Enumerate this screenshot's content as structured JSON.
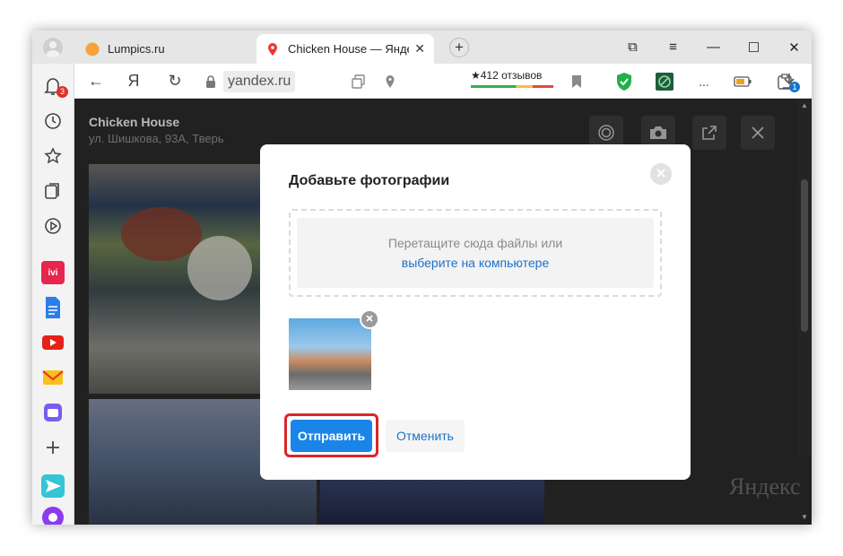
{
  "browser": {
    "tabs": [
      {
        "title": "Lumpics.ru",
        "favicon": "orange-circle-icon"
      },
      {
        "title": "Chicken House — Яндекс",
        "favicon": "map-pin-icon",
        "close": "✕"
      }
    ],
    "new_tab": "+",
    "window_controls": {
      "collections": "⧉",
      "menu": "≡",
      "minimize": "—",
      "maximize": "☐",
      "close": "✕"
    },
    "address": {
      "host": "yandex.ru"
    },
    "reviews": {
      "text": "★412 отзывов"
    },
    "nav": {
      "back": "←",
      "yandex": "Я",
      "reload": "↻"
    },
    "toolbar_extras": {
      "more": "..."
    }
  },
  "sidebar": {
    "notifications_badge": "3",
    "items": [
      "bell-icon",
      "history-icon",
      "star-icon",
      "collections-icon",
      "play-icon",
      "ivi-app",
      "docs-app",
      "youtube-app",
      "mail-app",
      "messenger-app",
      "add-icon",
      "alice-app"
    ],
    "ivi_label": "ivi"
  },
  "page": {
    "cafe": {
      "title": "Chicken House",
      "address": "ул. Шишкова, 93А, Тверь"
    },
    "watermark": "Яндекс"
  },
  "dialog": {
    "title": "Добавьте фотографии",
    "dropzone_text": "Перетащите сюда файлы или",
    "dropzone_link": "выберите на компьютере",
    "submit_label": "Отправить",
    "cancel_label": "Отменить"
  },
  "downloads_badge": "1",
  "colors": {
    "accent": "#1a85e8",
    "highlight": "#d9262a",
    "link": "#1a73c8"
  }
}
